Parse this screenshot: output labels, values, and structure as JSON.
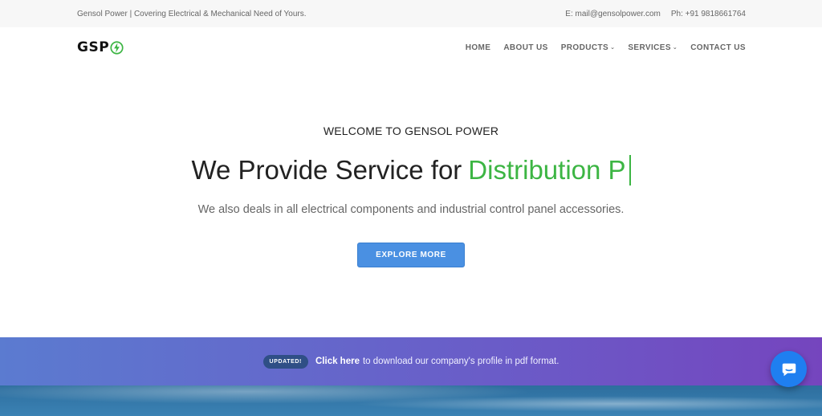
{
  "topbar": {
    "tagline": "Gensol Power | Covering Electrical & Mechanical Need of Yours.",
    "email": "E: mail@gensolpower.com",
    "phone": "Ph: +91 9818661764"
  },
  "nav": {
    "logo_text": "GSP",
    "items": [
      {
        "label": "HOME"
      },
      {
        "label": "ABOUT US"
      },
      {
        "label": "PRODUCTS",
        "dropdown": true
      },
      {
        "label": "SERVICES",
        "dropdown": true
      },
      {
        "label": "CONTACT US"
      }
    ]
  },
  "hero": {
    "welcome": "WELCOME TO GENSOL POWER",
    "headline_prefix": "We Provide Service for",
    "headline_accent": "Distribution P",
    "subtext": "We also deals in all electrical components and industrial control panel accessories.",
    "cta_label": "EXPLORE MORE"
  },
  "banner": {
    "badge": "UPDATED!",
    "link_text": "Click here",
    "rest_text": " to download our company's profile in pdf format."
  },
  "colors": {
    "accent_green": "#3cb543",
    "cta_blue": "#4a90e2",
    "chat_blue": "#1f7ff0"
  },
  "icons": {
    "logo_bolt": "lightning-bolt-icon",
    "chat": "chat-bubble-icon",
    "dropdown": "chevron-down-icon"
  }
}
